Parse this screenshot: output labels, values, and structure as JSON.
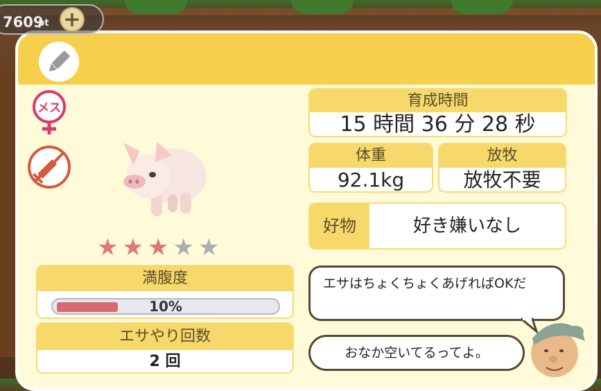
{
  "points": {
    "value": "7609",
    "unit": "pt",
    "add_label": "+"
  },
  "header": {
    "edit_icon": "pencil-icon"
  },
  "gender": {
    "label": "メス",
    "color": "#d93a6a"
  },
  "vaccine": {
    "icon": "syringe-icon",
    "color": "#d35a3a"
  },
  "rating": {
    "filled": 3,
    "total": 5,
    "stars": [
      "★",
      "★",
      "★",
      "★",
      "★"
    ]
  },
  "fullness": {
    "label": "満腹度",
    "value_text": "10%",
    "value": 0.1
  },
  "feed_count": {
    "label": "エサやり回数",
    "value": "2 回"
  },
  "growth_time": {
    "label": "育成時間",
    "value": "15 時間 36 分 28 秒"
  },
  "weight": {
    "label": "体重",
    "value": "92.1kg"
  },
  "grazing": {
    "label": "放牧",
    "value": "放牧不要"
  },
  "likes": {
    "label": "好物",
    "value": "好き嫌いなし"
  },
  "messages": {
    "tip": "エサはちょくちょくあげればOKだ",
    "status": "おなか空いてるってよ。"
  },
  "colors": {
    "header": "#f6cf4d",
    "panel": "#fffbd8",
    "accent": "#f6d96a",
    "star_on": "#df7779",
    "star_off": "#a8adb6"
  }
}
